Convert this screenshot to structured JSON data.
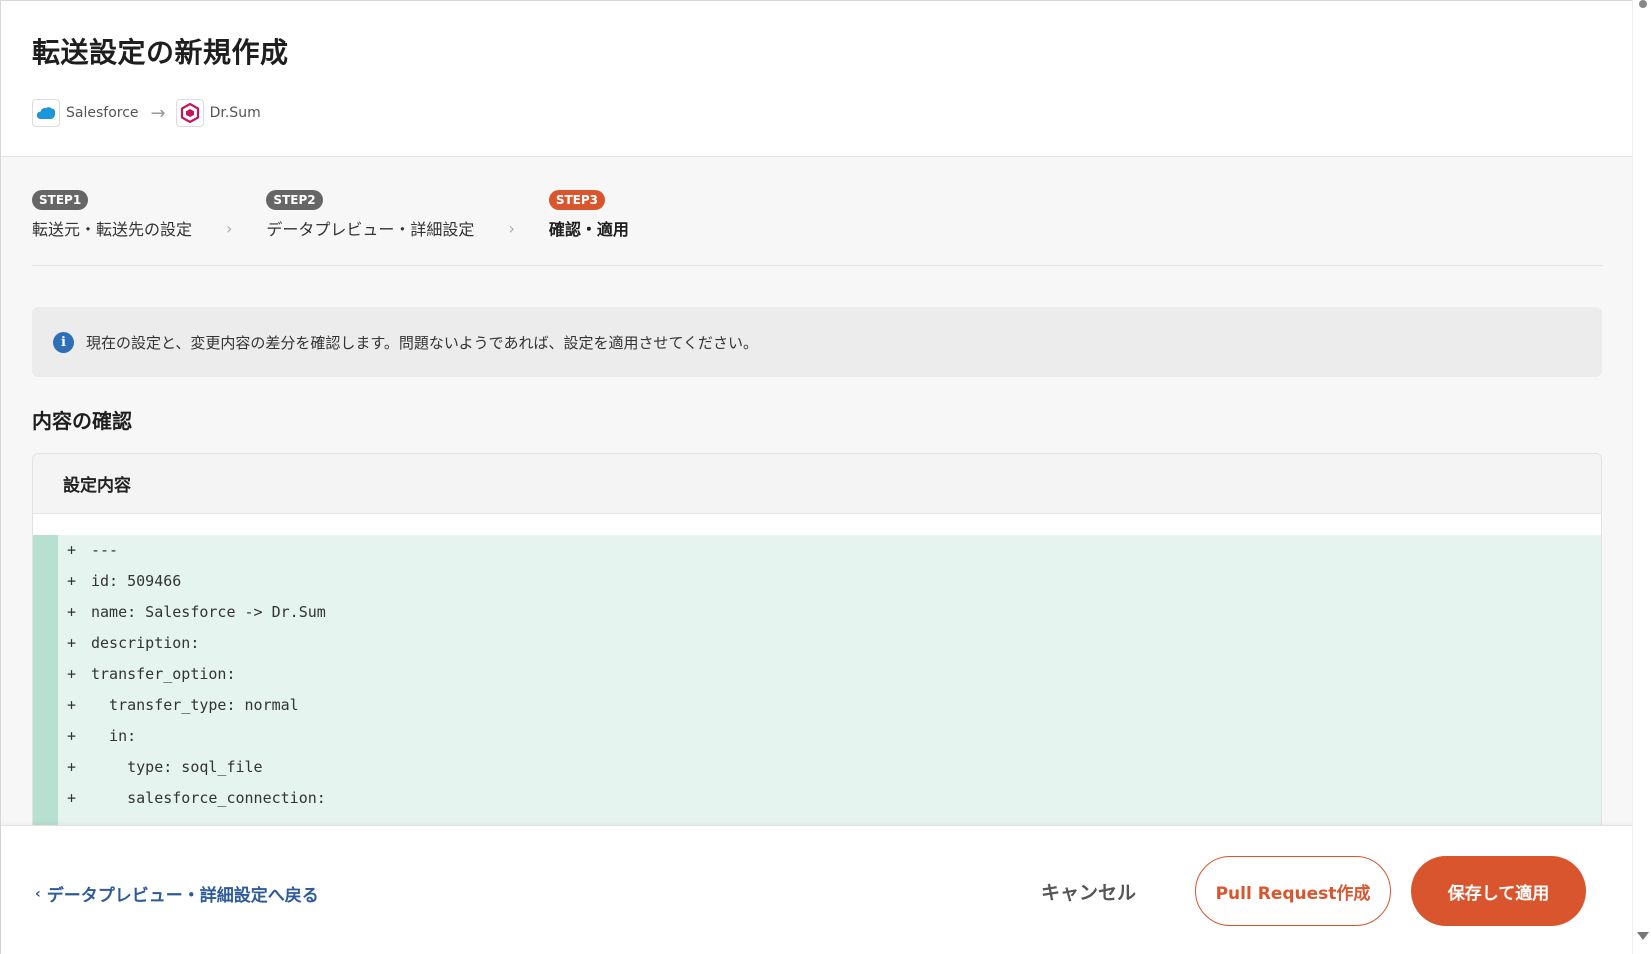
{
  "header": {
    "title": "転送設定の新規作成",
    "source": {
      "label": "Salesforce",
      "icon": "salesforce-cloud-icon",
      "color": "#1b96d8"
    },
    "destination": {
      "label": "Dr.Sum",
      "icon": "drsum-hexagon-icon",
      "color": "#c2185b"
    }
  },
  "steps": [
    {
      "badge": "STEP1",
      "label": "転送元・転送先の設定",
      "active": false
    },
    {
      "badge": "STEP2",
      "label": "データプレビュー・詳細設定",
      "active": false
    },
    {
      "badge": "STEP3",
      "label": "確認・適用",
      "active": true
    }
  ],
  "info": {
    "icon": "info-icon",
    "text": "現在の設定と、変更内容の差分を確認します。問題ないようであれば、設定を適用させてください。"
  },
  "section": {
    "title": "内容の確認"
  },
  "panel": {
    "title": "設定内容",
    "diff_lines": [
      {
        "sign": "+",
        "text": "---"
      },
      {
        "sign": "+",
        "text": "id: 509466"
      },
      {
        "sign": "+",
        "text": "name: Salesforce -> Dr.Sum"
      },
      {
        "sign": "+",
        "text": "description:"
      },
      {
        "sign": "+",
        "text": "transfer_option:"
      },
      {
        "sign": "+",
        "text": "  transfer_type: normal"
      },
      {
        "sign": "+",
        "text": "  in:"
      },
      {
        "sign": "+",
        "text": "    type: soql_file"
      },
      {
        "sign": "+",
        "text": "    salesforce_connection:"
      }
    ]
  },
  "footer": {
    "back_label": "データプレビュー・詳細設定へ戻る",
    "cancel_label": "キャンセル",
    "pr_label": "Pull Request作成",
    "save_label": "保存して適用"
  },
  "colors": {
    "accent": "#d8552e",
    "link": "#2d5b9a",
    "diff_bg": "#e6f4ef",
    "diff_gutter": "#b7e0d1"
  }
}
